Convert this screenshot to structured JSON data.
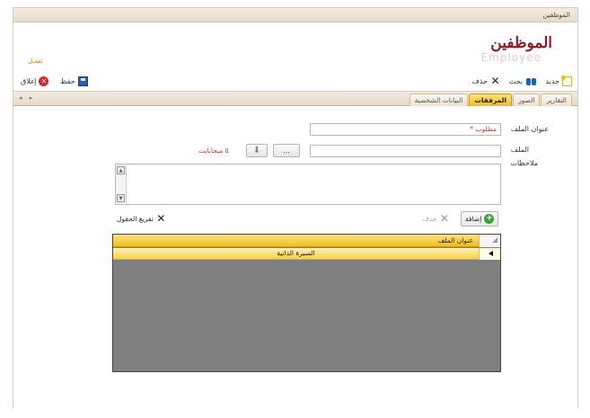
{
  "window": {
    "title": "الموظفين"
  },
  "header": {
    "title": "الموظفين",
    "subtitle_shadow": "Employee",
    "edit_label": "تعديل"
  },
  "toolbar": {
    "new_label": "جديد",
    "search_label": "بحث",
    "delete_label": "حذف",
    "save_label": "حفظ",
    "close_label": "إغلاق"
  },
  "nav": {
    "arrows": "◂ ▸"
  },
  "tabs": [
    {
      "label": "البيانات الشخصية",
      "active": false
    },
    {
      "label": "المرفقات",
      "active": true
    },
    {
      "label": "الصور",
      "active": false
    },
    {
      "label": "التقارير",
      "active": false
    }
  ],
  "form": {
    "file_title_label": "عنوان الملف",
    "file_title_placeholder": "مطلوب *",
    "file_label": "الملف",
    "notes_label": "ملاحظات",
    "browse_label": "...",
    "size_info": "٥ ميجابايت"
  },
  "actions": {
    "add_label": "إضافة",
    "delete_label": "حذف",
    "clear_label": "تفريغ الحقول"
  },
  "grid": {
    "columns": [
      "عنوان الملف"
    ],
    "rows": [
      {
        "file_title": "السيرة الذاتية"
      }
    ]
  },
  "colors": {
    "accent": "#f1bf24",
    "title": "#8a1f2a",
    "warning": "#c0392b"
  }
}
